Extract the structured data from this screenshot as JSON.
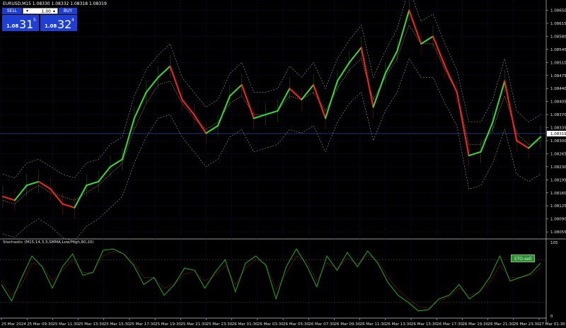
{
  "symbol_header": "EURUSD,M15  1.08330 1.08332 1.08318 1.08319",
  "trade_panel": {
    "sell_label": "SELL",
    "buy_label": "BUY",
    "lot_value": "1.00",
    "lot_dec": "▾",
    "lot_inc": "▴",
    "sell_price_small": "1.08",
    "sell_price_big": "31",
    "sell_price_sup": "5",
    "buy_price_small": "1.08",
    "buy_price_big": "32",
    "buy_price_sup": "4"
  },
  "stochastic_title": "Stochastic (M15,14,3,3,SMMA,Low/High,80,20)",
  "sto_badge": "STO-sell",
  "colors": {
    "up": "#33dd33",
    "down": "#ff2020",
    "envelope": "#9a9a9a",
    "grid": "#10104a",
    "stoch_main": "#18b018",
    "stoch_signal": "#c02020",
    "current_price": "#3a4fc8"
  },
  "chart_data": {
    "type": "line",
    "symbol": "EURUSD",
    "timeframe": "M15",
    "ohlc": {
      "open": 1.0833,
      "high": 1.08332,
      "low": 1.08318,
      "close": 1.08319
    },
    "current_price_label": "1.08319",
    "y_ticks": [
      "1.08650",
      "1.08615",
      "1.08580",
      "1.08545",
      "1.08510",
      "1.08475",
      "1.08440",
      "1.08405",
      "1.08370",
      "1.08335",
      "1.08300",
      "1.08265",
      "1.08230",
      "1.08195",
      "1.08160",
      "1.08125",
      "1.08090",
      "1.08055"
    ],
    "ylim": [
      1.0804,
      1.0867
    ],
    "x_ticks": [
      "25 Mar 2024",
      "25 Mar 09:30",
      "25 Mar 11:30",
      "25 Mar 13:30",
      "25 Mar 15:30",
      "25 Mar 17:30",
      "25 Mar 19:30",
      "25 Mar 21:30",
      "25 Mar 23:30",
      "26 Mar 01:30",
      "26 Mar 03:30",
      "26 Mar 05:30",
      "26 Mar 07:30",
      "26 Mar 09:30",
      "26 Mar 11:30",
      "26 Mar 13:30",
      "26 Mar 15:30",
      "26 Mar 17:30",
      "26 Mar 19:30",
      "26 Mar 21:30",
      "26 Mar 23:30",
      "27 Mar 01:30"
    ],
    "series": [
      {
        "values": [
          1.0815,
          1.0814,
          1.0818,
          1.0819,
          1.0817,
          1.0813,
          1.0812,
          1.0818,
          1.0819,
          1.0823,
          1.0825,
          1.0836,
          1.0843,
          1.0847,
          1.085,
          1.0841,
          1.0837,
          1.0832,
          1.0834,
          1.0842,
          1.0845,
          1.0836,
          1.0837,
          1.0838,
          1.0844,
          1.0841,
          1.0845,
          1.0836,
          1.0846,
          1.0851,
          1.0855,
          1.0839,
          1.0848,
          1.0854,
          1.0865,
          1.0856,
          1.0858,
          1.085,
          1.0843,
          1.0826,
          1.0827,
          1.0835,
          1.0846,
          1.083,
          1.0828,
          1.0831
        ]
      },
      {
        "values": [
          1.0814,
          1.0813,
          1.0816,
          1.0818,
          1.0816,
          1.0815,
          1.0814,
          1.0816,
          1.0818,
          1.0821,
          1.0824,
          1.0833,
          1.084,
          1.0845,
          1.0846,
          1.084,
          1.0836,
          1.0833,
          1.0835,
          1.084,
          1.0842,
          1.0837,
          1.0837,
          1.0838,
          1.0842,
          1.0841,
          1.0843,
          1.0838,
          1.0844,
          1.0849,
          1.0852,
          1.0841,
          1.0847,
          1.0852,
          1.0861,
          1.0856,
          1.0856,
          1.0849,
          1.0843,
          1.0829,
          1.0829,
          1.0833,
          1.0842,
          1.0832,
          1.0829,
          1.083
        ]
      }
    ],
    "stochastic": {
      "levels": [
        "105",
        "0"
      ],
      "ylim": [
        0,
        105
      ],
      "main": [
        45,
        22,
        55,
        85,
        70,
        40,
        70,
        88,
        58,
        62,
        93,
        95,
        88,
        72,
        45,
        55,
        30,
        45,
        68,
        65,
        40,
        62,
        80,
        35,
        75,
        85,
        72,
        25,
        70,
        95,
        72,
        42,
        85,
        65,
        90,
        70,
        92,
        75,
        48,
        30,
        20,
        8,
        10,
        25,
        30,
        45,
        25,
        35,
        55,
        85,
        50,
        55,
        60,
        75
      ],
      "signal": [
        50,
        30,
        45,
        75,
        72,
        50,
        65,
        80,
        62,
        62,
        85,
        92,
        88,
        76,
        55,
        55,
        40,
        45,
        60,
        63,
        50,
        58,
        72,
        45,
        68,
        80,
        74,
        38,
        60,
        85,
        78,
        50,
        75,
        68,
        82,
        74,
        86,
        78,
        55,
        38,
        25,
        14,
        12,
        22,
        28,
        40,
        30,
        35,
        48,
        72,
        55,
        55,
        58,
        68
      ]
    }
  }
}
